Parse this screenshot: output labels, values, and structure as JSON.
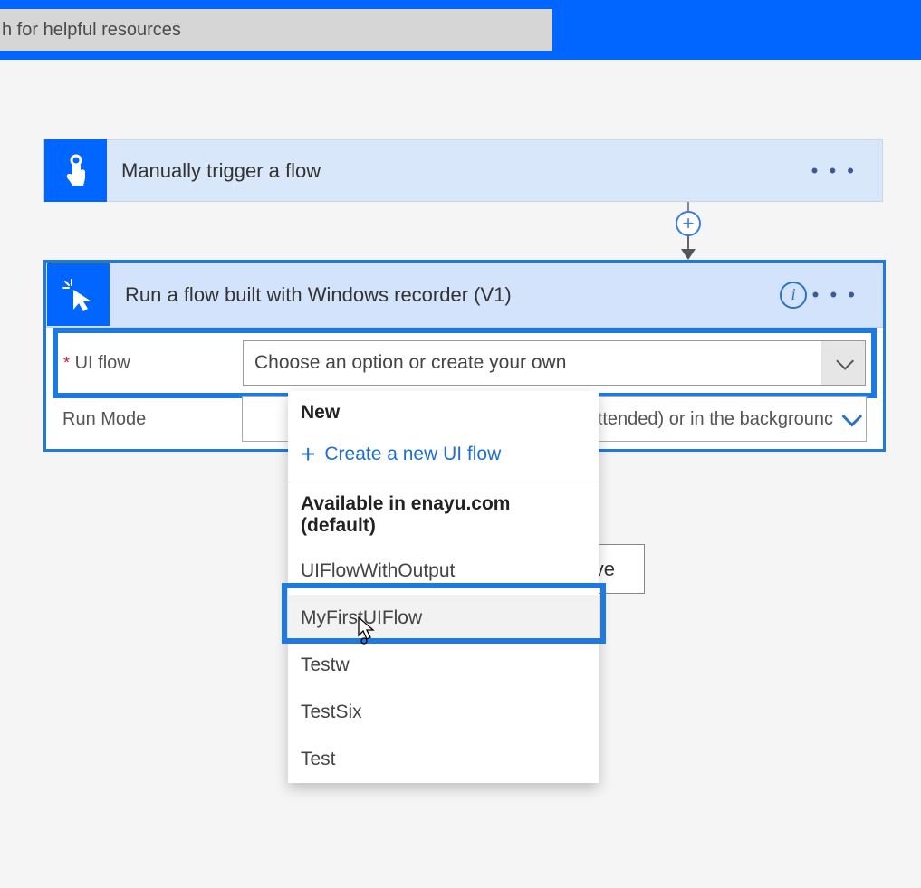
{
  "header": {
    "search_placeholder": "h for helpful resources"
  },
  "trigger": {
    "title": "Manually trigger a flow"
  },
  "action": {
    "title": "Run a flow built with Windows recorder (V1)",
    "uiFlow": {
      "label": "UI flow",
      "placeholder": "Choose an option or create your own"
    },
    "runMode": {
      "label": "Run Mode",
      "visible_text": "n (attended) or in the backgrounc"
    }
  },
  "dropdown": {
    "section_new": "New",
    "create_label": "Create a new UI flow",
    "section_available": "Available in enayu.com (default)",
    "options": [
      "UIFlowWithOutput",
      "MyFirstUIFlow",
      "Testw",
      "TestSix",
      "Test"
    ]
  },
  "save_button": {
    "label_visible": "ave"
  }
}
